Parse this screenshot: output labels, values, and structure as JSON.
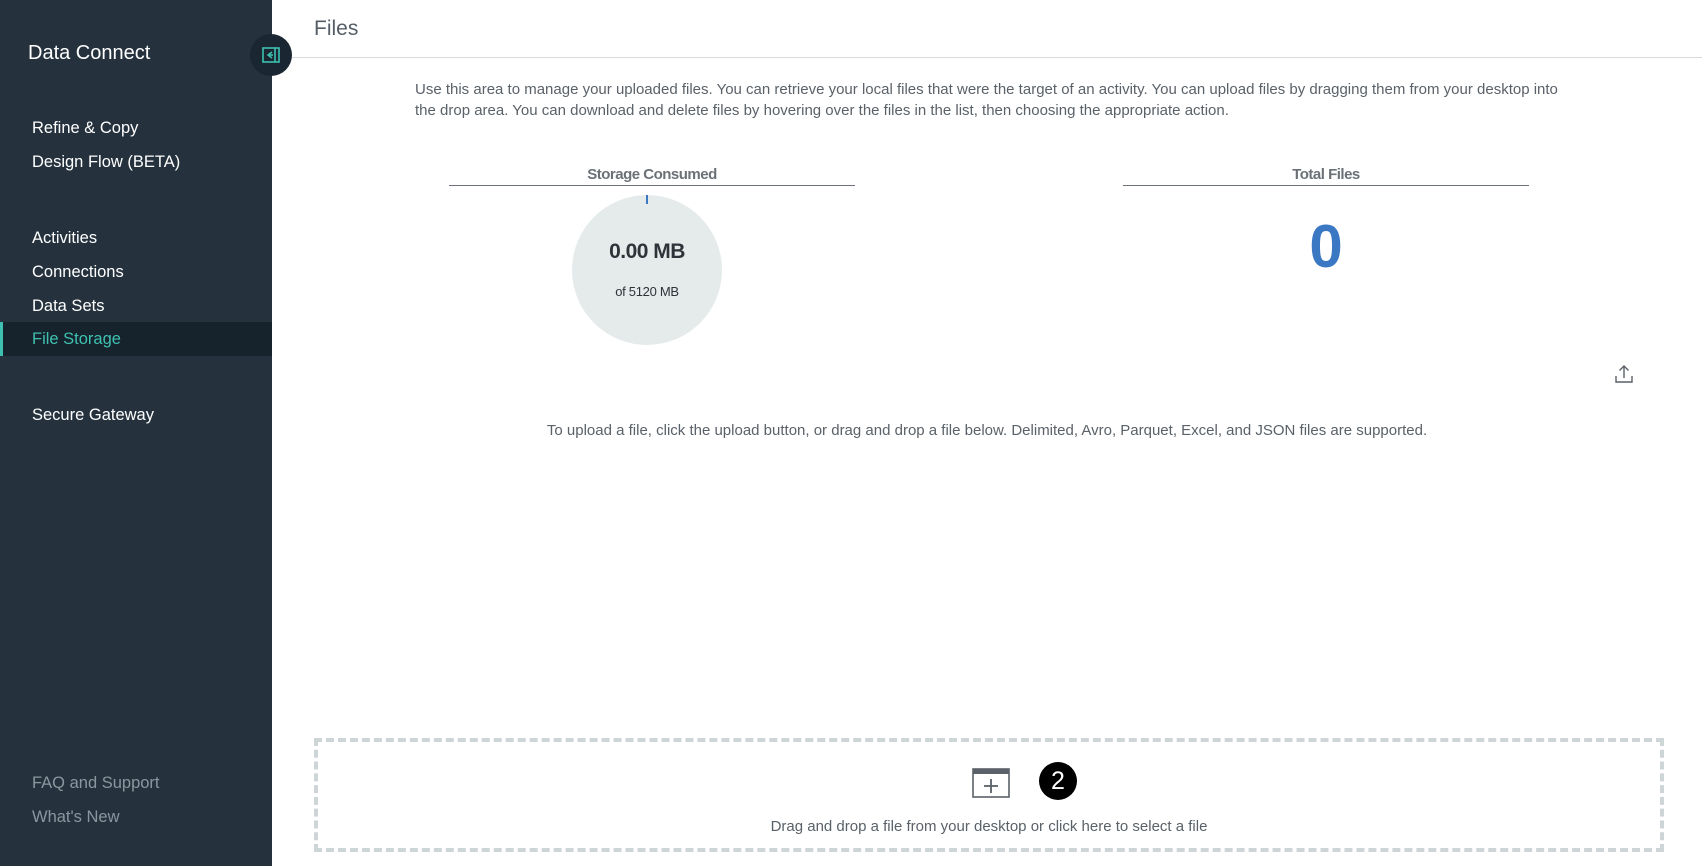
{
  "sidebar": {
    "app_title": "Data Connect",
    "items": [
      {
        "label": "Refine & Copy"
      },
      {
        "label": "Design Flow (BETA)"
      },
      {
        "label": "Activities"
      },
      {
        "label": "Connections"
      },
      {
        "label": "Data Sets"
      },
      {
        "label": "File Storage",
        "active": true
      },
      {
        "label": "Secure Gateway"
      }
    ],
    "footer": [
      {
        "label": "FAQ and Support"
      },
      {
        "label": "What's New"
      }
    ],
    "collapse_icon": "collapse-sidebar-icon"
  },
  "header": {
    "title": "Files"
  },
  "main": {
    "description": "Use this area to manage your uploaded files. You can retrieve your local files that were the target of an activity. You can upload files by dragging them from your desktop into the drop area. You can download and delete files by hovering over the files in the list, then choosing the appropriate action.",
    "storage": {
      "title": "Storage Consumed",
      "value": "0.00 MB",
      "capacity": "of 5120 MB",
      "used_fraction": 0.0
    },
    "total_files": {
      "title": "Total Files",
      "value": "0"
    },
    "upload_icon": "upload-icon",
    "upload_hint": "To upload a file, click the upload button, or drag and drop a file below. Delimited, Avro, Parquet, Excel, and JSON files are supported.",
    "dropzone": {
      "text": "Drag and drop a file from your desktop or click here to select a file",
      "icon": "add-file-icon"
    },
    "step_badge": "2"
  },
  "colors": {
    "sidebar_bg": "#25323e",
    "accent": "#3ec0b0",
    "total_files": "#3a78c4",
    "donut_bg": "#e5ebeb"
  }
}
